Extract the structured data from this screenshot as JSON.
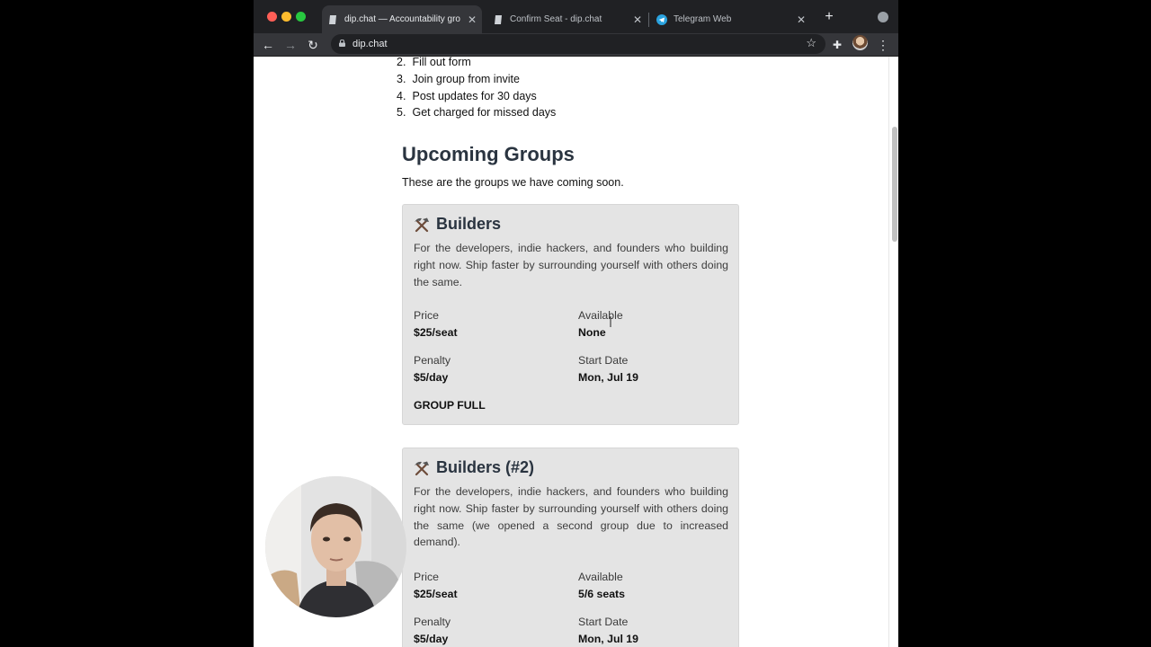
{
  "browser": {
    "tabs": [
      {
        "title": "dip.chat — Accountability gro",
        "active": true
      },
      {
        "title": "Confirm Seat - dip.chat",
        "active": false
      },
      {
        "title": "Telegram Web",
        "active": false
      }
    ],
    "url": "dip.chat"
  },
  "page": {
    "steps": [
      {
        "num": "2.",
        "text": "Fill out form"
      },
      {
        "num": "3.",
        "text": "Join group from invite"
      },
      {
        "num": "4.",
        "text": "Post updates for 30 days"
      },
      {
        "num": "5.",
        "text": "Get charged for missed days"
      }
    ],
    "section_title": "Upcoming Groups",
    "section_intro": "These are the groups we have coming soon.",
    "groups": [
      {
        "icon": "hammer-and-pick-icon",
        "title": "Builders",
        "description": "For the developers, indie hackers, and founders who building right now. Ship faster by surrounding yourself with others doing the same.",
        "price_label": "Price",
        "price": "$25/seat",
        "available_label": "Available",
        "available": "None",
        "penalty_label": "Penalty",
        "penalty": "$5/day",
        "start_label": "Start Date",
        "start": "Mon, Jul 19",
        "status": "GROUP FULL"
      },
      {
        "icon": "hammer-and-pick-icon",
        "title": "Builders (#2)",
        "description": "For the developers, indie hackers, and founders who building right now. Ship faster by surrounding yourself with others doing the same (we opened a second group due to increased demand).",
        "price_label": "Price",
        "price": "$25/seat",
        "available_label": "Available",
        "available": "5/6 seats",
        "penalty_label": "Penalty",
        "penalty": "$5/day",
        "start_label": "Start Date",
        "start": "Mon, Jul 19"
      }
    ]
  },
  "colors": {
    "card_bg": "#e4e4e4",
    "heading": "#2a3440",
    "chrome_dark": "#202124",
    "chrome_toolbar": "#35363a"
  }
}
